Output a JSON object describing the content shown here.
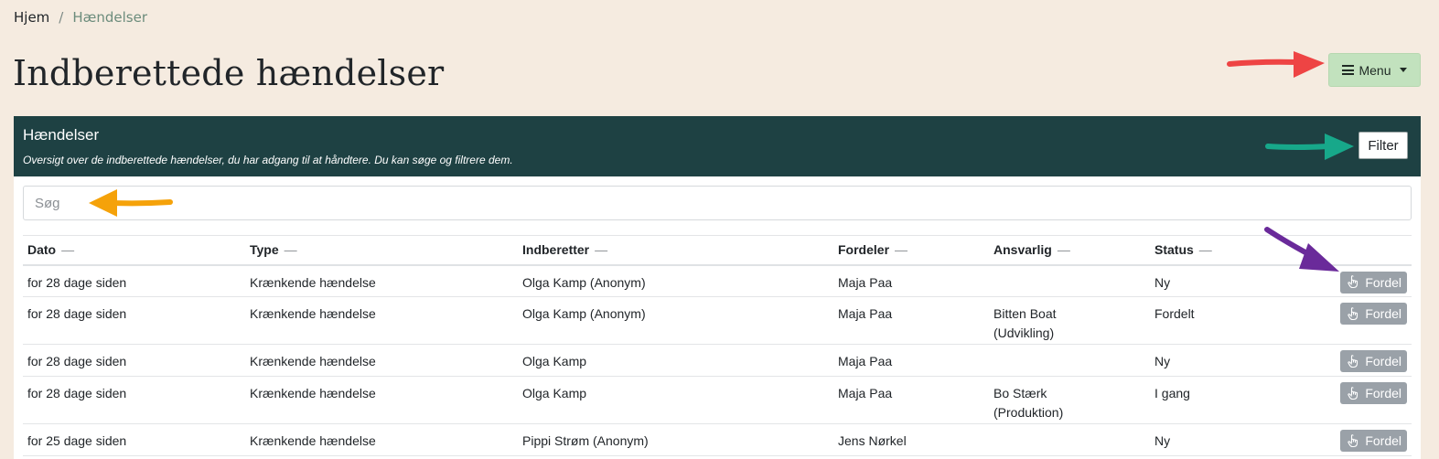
{
  "breadcrumb": {
    "home": "Hjem",
    "separator": "/",
    "current": "Hændelser"
  },
  "page_title": "Indberettede hændelser",
  "menu_button": {
    "label": "Menu",
    "icon": "list-icon"
  },
  "card": {
    "title": "Hændelser",
    "subtitle": "Oversigt over de indberettede hændelser, du har adgang til at håndtere. Du kan søge og filtrere dem.",
    "filter_label": "Filter"
  },
  "search": {
    "placeholder": "Søg",
    "value": ""
  },
  "table": {
    "columns": [
      "Dato",
      "Type",
      "Indberetter",
      "Fordeler",
      "Ansvarlig",
      "Status"
    ],
    "sort_indicator": "—",
    "action_label": "Fordel",
    "rows": [
      {
        "dato": "for 28 dage siden",
        "type": "Krænkende hændelse",
        "indberetter": "Olga Kamp (Anonym)",
        "fordeler": "Maja Paa",
        "ansvarlig_name": "",
        "ansvarlig_dept": "",
        "status": "Ny"
      },
      {
        "dato": "for 28 dage siden",
        "type": "Krænkende hændelse",
        "indberetter": "Olga Kamp (Anonym)",
        "fordeler": "Maja Paa",
        "ansvarlig_name": "Bitten Boat",
        "ansvarlig_dept": "(Udvikling)",
        "status": "Fordelt"
      },
      {
        "dato": "for 28 dage siden",
        "type": "Krænkende hændelse",
        "indberetter": "Olga Kamp",
        "fordeler": "Maja Paa",
        "ansvarlig_name": "",
        "ansvarlig_dept": "",
        "status": "Ny"
      },
      {
        "dato": "for 28 dage siden",
        "type": "Krænkende hændelse",
        "indberetter": "Olga Kamp",
        "fordeler": "Maja Paa",
        "ansvarlig_name": "Bo Stærk",
        "ansvarlig_dept": "(Produktion)",
        "status": "I gang"
      },
      {
        "dato": "for 25 dage siden",
        "type": "Krænkende hændelse",
        "indberetter": "Pippi Strøm (Anonym)",
        "fordeler": "Jens Nørkel",
        "ansvarlig_name": "",
        "ansvarlig_dept": "",
        "status": "Ny"
      }
    ]
  },
  "colors": {
    "background": "#f5ebe0",
    "header_dark_teal": "#1e4143",
    "menu_green": "#c2e2be",
    "fordel_gray": "#9aa1a8",
    "arrow_red": "#ee4444",
    "arrow_teal": "#17a88a",
    "arrow_orange": "#f5a20a",
    "arrow_purple": "#6a2a9a"
  }
}
